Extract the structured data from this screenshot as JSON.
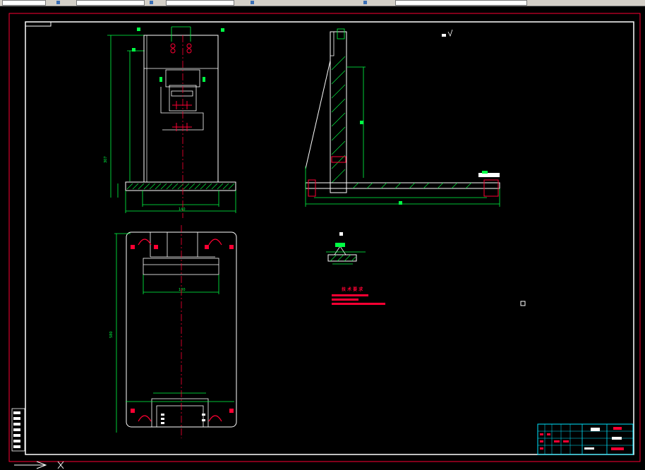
{
  "app": {
    "name": "CAD drawing editor"
  },
  "toolbar": {
    "fields": [
      {
        "name": "layer-dropdown"
      },
      {
        "name": "linetype-dropdown"
      },
      {
        "name": "lineweight-dropdown"
      },
      {
        "name": "color-dropdown"
      }
    ],
    "icons": [
      "layer-icon",
      "properties-icon",
      "match-icon",
      "plot-style-icon"
    ]
  },
  "drawing": {
    "views": [
      "front-view",
      "side-section-view",
      "top-view",
      "detail-view"
    ],
    "dimension_labels": [
      "140",
      "307",
      "100",
      "580"
    ],
    "annotations": {
      "tech_title": "技 术 要 求"
    },
    "colors": {
      "border": "#ff0033",
      "geometry": "#ffffff",
      "dimensions": "#00ff44",
      "centerline": "#ff0033",
      "hatch": "#00ff44",
      "titleblock": "#00e5ff",
      "annotation_red": "#ff0033"
    }
  },
  "title_block": {
    "position_word": "bottom-right"
  }
}
